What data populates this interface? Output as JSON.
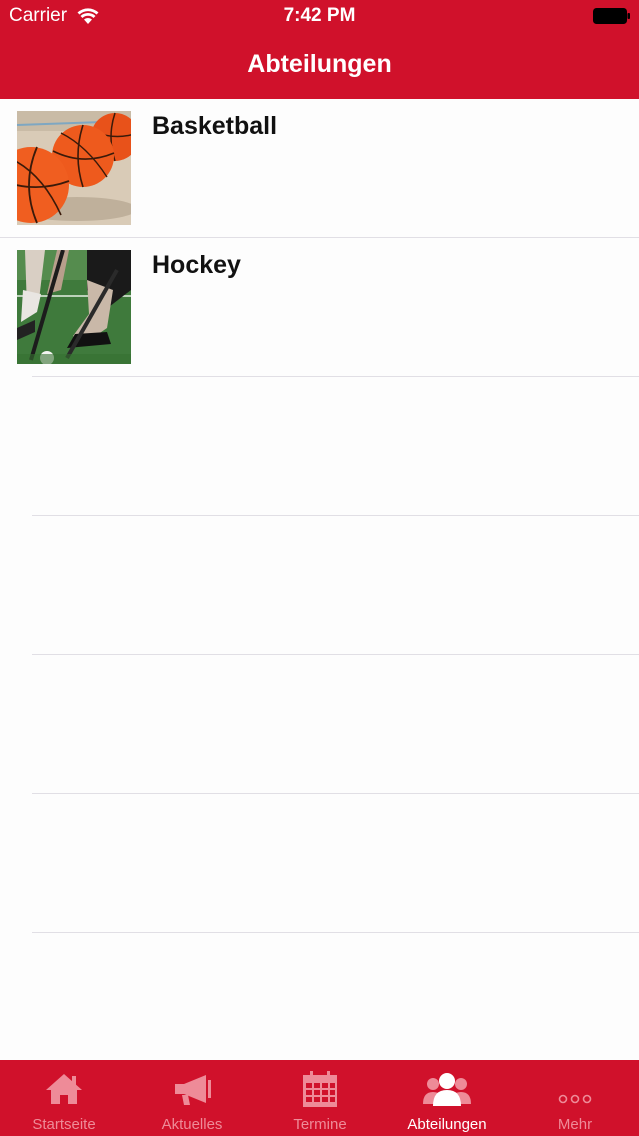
{
  "status_bar": {
    "carrier": "Carrier",
    "time": "7:42 PM"
  },
  "nav": {
    "title": "Abteilungen"
  },
  "departments": [
    {
      "title": "Basketball",
      "image": "basketball-photo"
    },
    {
      "title": "Hockey",
      "image": "hockey-photo"
    }
  ],
  "tabs": [
    {
      "label": "Startseite",
      "icon": "home-icon",
      "active": false
    },
    {
      "label": "Aktuelles",
      "icon": "megaphone-icon",
      "active": false
    },
    {
      "label": "Termine",
      "icon": "calendar-icon",
      "active": false
    },
    {
      "label": "Abteilungen",
      "icon": "people-icon",
      "active": true
    },
    {
      "label": "Mehr",
      "icon": "more-icon",
      "active": false
    }
  ],
  "colors": {
    "brand": "#d0112b",
    "tab_inactive": "#ee8b98",
    "tab_active": "#ffffff",
    "separator": "#e1dfe5"
  }
}
